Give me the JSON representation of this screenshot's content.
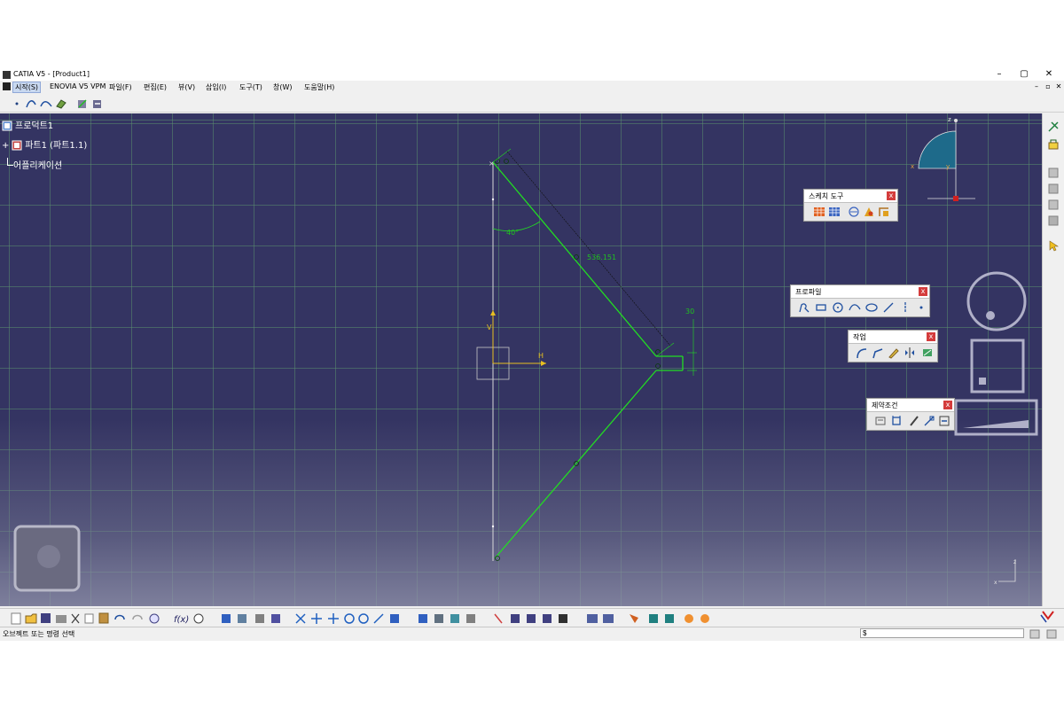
{
  "window": {
    "title": "CATIA V5 - [Product1]",
    "minimize": "–",
    "maximize": "▢",
    "close": "✕"
  },
  "menu": {
    "items": [
      "시작(S)",
      "ENOVIA V5 VPM",
      "파일(F)",
      "편집(E)",
      "뷰(V)",
      "삽입(I)",
      "도구(T)",
      "창(W)",
      "도움말(H)"
    ],
    "mdi": {
      "minimize": "–",
      "restore": "▫",
      "close": "✕"
    }
  },
  "tree": {
    "root": "프로덕트1",
    "part": "파트1 (파트1.1)",
    "app": "어플리케이션"
  },
  "palettes": {
    "sketch_tools": {
      "title": "스케치 도구"
    },
    "profile": {
      "title": "프로파일"
    },
    "operation": {
      "title": "작업"
    },
    "constraint": {
      "title": "제약조건"
    }
  },
  "sketch": {
    "angle_label": "40°",
    "length_label": "536.151",
    "height_label": "30",
    "h_axis": "H",
    "v_axis": "V"
  },
  "compass": {
    "z": "z",
    "x": "x",
    "y": "y"
  },
  "corner_axis": {
    "z": "z",
    "x": "x"
  },
  "status": {
    "text": "오브젝트 또는 명령 선택",
    "command_value": "$"
  },
  "colors": {
    "sketch": "#22dd22",
    "axis": "#e8c020",
    "background": "#343462",
    "grid": "#4a8a6e",
    "close_red": "#d43c3c"
  }
}
